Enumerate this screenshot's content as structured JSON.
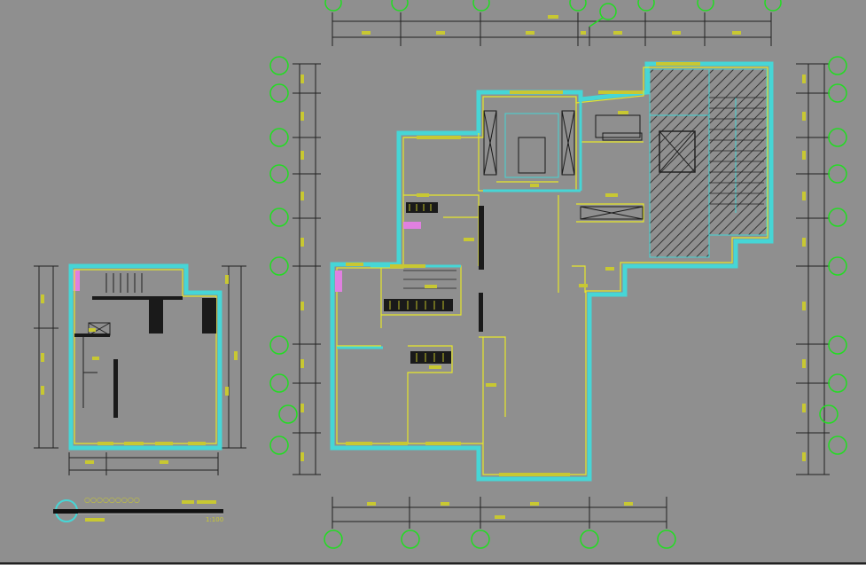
{
  "colors": {
    "background": "#8f8f8f",
    "wall_outer": "#46d6d6",
    "wall_line": "#e6e62a",
    "dim_line": "#222222",
    "dim_text": "#c8c832",
    "axis_bubble": "#22dd22",
    "hatch": "#333333",
    "furniture": "#1a1a1a",
    "magenta": "#e080e0"
  },
  "drawing": {
    "title_block": {
      "dots_label": "○○○○○○○○○",
      "scale_label": "1:100"
    }
  }
}
